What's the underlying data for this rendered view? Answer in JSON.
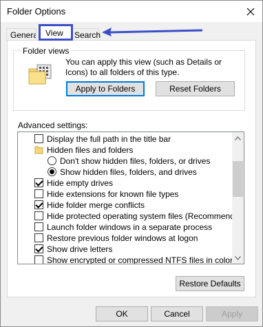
{
  "window": {
    "title": "Folder Options"
  },
  "tabs": [
    {
      "label": "General"
    },
    {
      "label": "View",
      "selected": true
    },
    {
      "label": "Search"
    }
  ],
  "folder_views": {
    "legend": "Folder views",
    "description": "You can apply this view (such as Details or Icons) to all folders of this type.",
    "apply_button": "Apply to Folders",
    "reset_button": "Reset Folders"
  },
  "advanced": {
    "label": "Advanced settings:",
    "items": [
      {
        "type": "checkbox",
        "checked": false,
        "label": "Display the full path in the title bar"
      },
      {
        "type": "folder",
        "label": "Hidden files and folders"
      },
      {
        "type": "radio",
        "checked": false,
        "label": "Don't show hidden files, folders, or drives"
      },
      {
        "type": "radio",
        "checked": true,
        "label": "Show hidden files, folders, and drives"
      },
      {
        "type": "checkbox",
        "checked": true,
        "label": "Hide empty drives"
      },
      {
        "type": "checkbox",
        "checked": false,
        "label": "Hide extensions for known file types"
      },
      {
        "type": "checkbox",
        "checked": true,
        "label": "Hide folder merge conflicts"
      },
      {
        "type": "checkbox",
        "checked": false,
        "label": "Hide protected operating system files (Recommended)"
      },
      {
        "type": "checkbox",
        "checked": false,
        "label": "Launch folder windows in a separate process"
      },
      {
        "type": "checkbox",
        "checked": false,
        "label": "Restore previous folder windows at logon"
      },
      {
        "type": "checkbox",
        "checked": true,
        "label": "Show drive letters"
      },
      {
        "type": "checkbox",
        "checked": false,
        "label": "Show encrypted or compressed NTFS files in color"
      }
    ]
  },
  "restore_defaults": "Restore Defaults",
  "footer": {
    "ok": "OK",
    "cancel": "Cancel",
    "apply": "Apply"
  },
  "colors": {
    "highlight": "#3a4ec8",
    "focus": "#0078d7",
    "folder": "#f5d77a"
  }
}
